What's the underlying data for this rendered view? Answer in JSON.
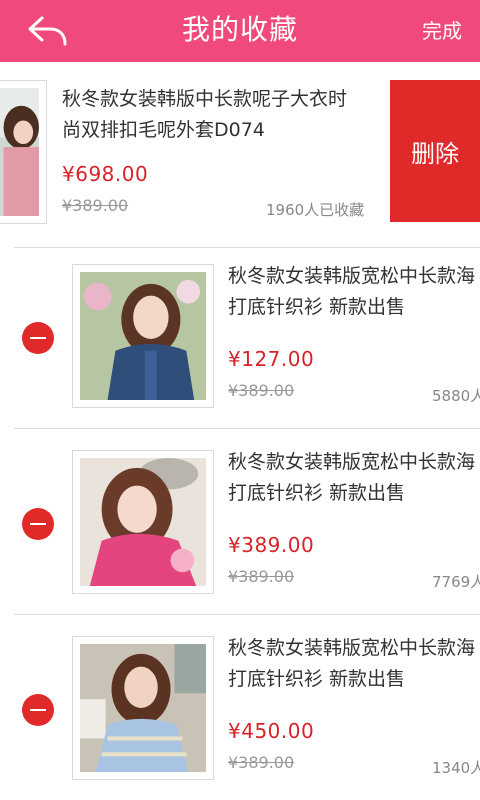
{
  "header": {
    "title": "我的收藏",
    "done_label": "完成"
  },
  "first_item": {
    "name_line1": "秋冬款女装韩版中长款呢子大衣时",
    "name_line2": "尚双排扣毛呢外套D074",
    "price": "¥698.00",
    "old_price": "¥389.00",
    "favorites": "1960人已收藏",
    "delete_label": "删除"
  },
  "items": [
    {
      "name_line1": "秋冬款女装韩版宽松中长款海",
      "name_line2": "打底针织衫 新款出售",
      "price": "¥127.00",
      "old_price": "¥389.00",
      "favorites": "5880人"
    },
    {
      "name_line1": "秋冬款女装韩版宽松中长款海",
      "name_line2": "打底针织衫 新款出售",
      "price": "¥389.00",
      "old_price": "¥389.00",
      "favorites": "7769人"
    },
    {
      "name_line1": "秋冬款女装韩版宽松中长款海",
      "name_line2": "打底针织衫 新款出售",
      "price": "¥450.00",
      "old_price": "¥389.00",
      "favorites": "1340人"
    }
  ],
  "colors": {
    "header": "#ef4a7b",
    "price": "#d7232a",
    "delete": "#e02a2a"
  }
}
